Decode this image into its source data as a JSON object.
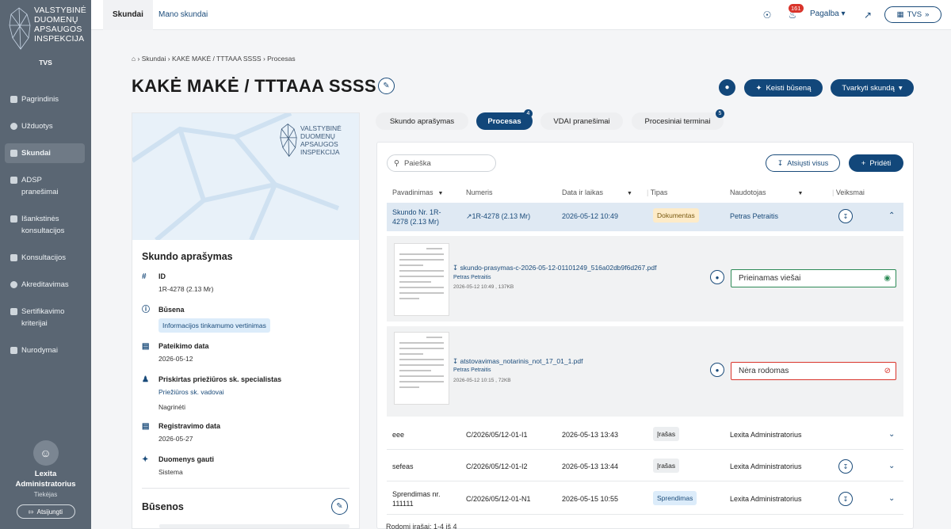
{
  "sidebar": {
    "logo_lines": [
      "VALSTYBINĖ",
      "DUOMENŲ",
      "APSAUGOS",
      "INSPEKCIJA"
    ],
    "org_short": "TVS",
    "items": [
      {
        "label": "Pagrindinis",
        "icon": "home-icon"
      },
      {
        "label": "Užduotys",
        "icon": "tasks-icon"
      },
      {
        "label": "Skundai",
        "icon": "complaints-icon",
        "active": true
      },
      {
        "label": "ADSP pranešimai",
        "icon": "shield-icon"
      },
      {
        "label": "Išankstinės konsultacijos",
        "icon": "doc-icon"
      },
      {
        "label": "Konsultacijos",
        "icon": "chat-icon"
      },
      {
        "label": "Akreditavimas",
        "icon": "cert-icon"
      },
      {
        "label": "Sertifikavimo kriterijai",
        "icon": "list-icon"
      },
      {
        "label": "Nurodymai",
        "icon": "shield-icon"
      }
    ],
    "user": {
      "name_line1": "Lexita",
      "name_line2": "Administratorius",
      "role": "Tiekėjas",
      "logout": "Atsijungti"
    }
  },
  "topbar": {
    "tabs": [
      {
        "label": "Skundai",
        "active": true
      },
      {
        "label": "Mano skundai"
      }
    ],
    "notifications": "161",
    "help": "Pagalba",
    "tvs_button": "TVS"
  },
  "breadcrumb": [
    "Skundai",
    "KAKĖ MAKĖ / TTTAAA SSSS",
    "Procesas"
  ],
  "page_title": "KAKĖ MAKĖ / TTTAAA SSSS",
  "actions": {
    "change_status": "Keisti būseną",
    "manage": "Tvarkyti skundą"
  },
  "left_card": {
    "banner_logo": [
      "VALSTYBINĖ",
      "DUOMENŲ",
      "APSAUGOS",
      "INSPEKCIJA"
    ],
    "section_title": "Skundo aprašymas",
    "fields": {
      "id": {
        "label": "ID",
        "value": "1R-4278 (2.13 Mr)"
      },
      "status": {
        "label": "Būsena",
        "value": "Informacijos tinkamumo vertinimas"
      },
      "submit_date": {
        "label": "Pateikimo data",
        "value": "2026-05-12"
      },
      "specialist": {
        "label": "Priskirtas priežiūros sk. specialistas",
        "value": "Priežiūros sk. vadovai",
        "value2": "Nagrinėti"
      },
      "reg_date": {
        "label": "Registravimo data",
        "value": "2026-05-27"
      },
      "data_received": {
        "label": "Duomenys gauti",
        "value": "Sistema"
      }
    },
    "statuses_title": "Būsenos"
  },
  "tabs": [
    {
      "label": "Skundo aprašymas"
    },
    {
      "label": "Procesas",
      "active": true,
      "badge": "4"
    },
    {
      "label": "VDAI pranešimai"
    },
    {
      "label": "Procesiniai terminai",
      "badge": "5"
    }
  ],
  "table": {
    "search_placeholder": "Paieška",
    "download_all": "Atsiųsti visus",
    "add": "Pridėti",
    "headers": [
      "Pavadinimas",
      "Numeris",
      "Data ir laikas",
      "Tipas",
      "Naudotojas",
      "Veiksmai"
    ],
    "rows": [
      {
        "name": "Skundo Nr. 1R-4278 (2.13 Mr)",
        "name_l1": "Skundo Nr. 1R-",
        "name_l2": "4278 (2.13 Mr)",
        "number": "1R-4278 (2.13 Mr)",
        "datetime": "2026-05-12 10:49",
        "type": "Dokumentas",
        "user": "Petras Petraitis"
      },
      {
        "name": "eee",
        "number": "C/2026/05/12-01-I1",
        "datetime": "2026-05-13 13:43",
        "type": "Įrašas",
        "user": "Lexita Administratorius"
      },
      {
        "name": "sefeas",
        "number": "C/2026/05/12-01-I2",
        "datetime": "2026-05-13 13:44",
        "type": "Įrašas",
        "user": "Lexita Administratorius"
      },
      {
        "name_l1": "Sprendimas nr.",
        "name_l2": "111111",
        "number": "C/2026/05/12-01-N1",
        "datetime": "2026-05-15 10:55",
        "type": "Sprendimas",
        "user": "Lexita Administratorius"
      }
    ],
    "files": [
      {
        "filename": "skundo-prasymas-c-2026-05-12-01101249_516a02db9f6d267.pdf",
        "author": "Petras Petraitis",
        "meta": "2026-05-12 10:49 , 137KB",
        "visibility": "Prieinamas viešai"
      },
      {
        "filename": "atstovavimas_notarinis_not_17_01_1.pdf",
        "author": "Petras Petraitis",
        "meta": "2026-05-12 10:15 , 72KB",
        "visibility": "Nėra rodomas"
      }
    ],
    "footer": "Rodomi įrašai: 1-4 iš 4"
  },
  "colors": {
    "sidebar": "#5a6673",
    "primary": "#12477a",
    "success": "#2e8b57",
    "danger": "#d9342b"
  }
}
